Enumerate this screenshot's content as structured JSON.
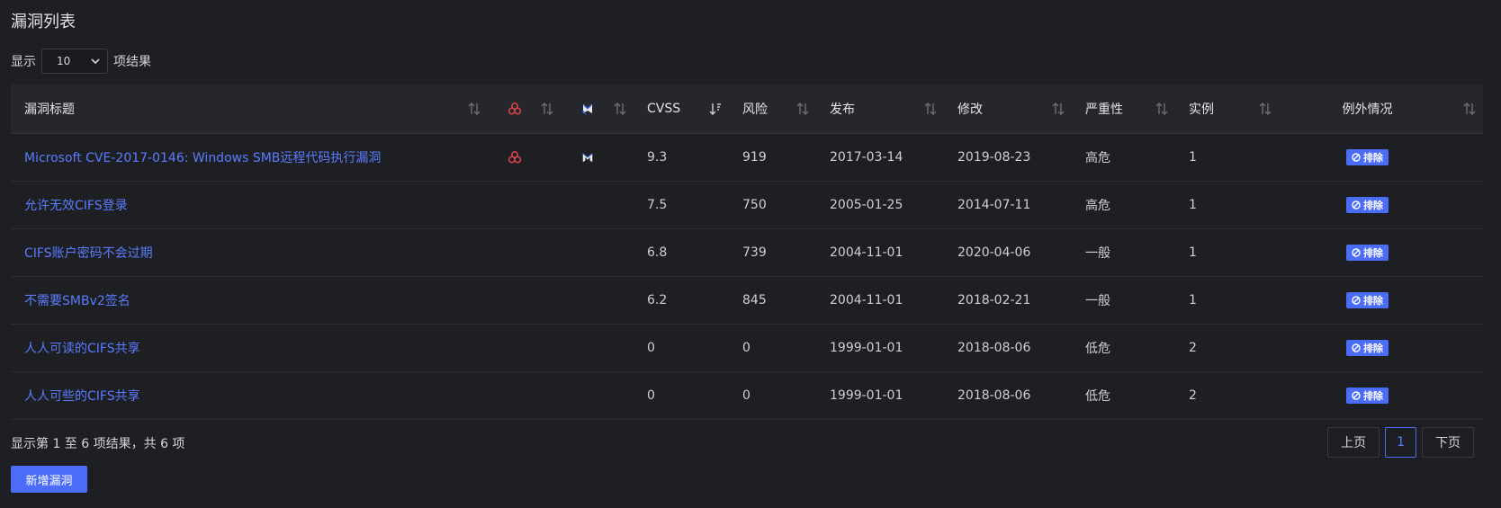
{
  "title": "漏洞列表",
  "length_menu": {
    "prefix": "显示",
    "value": "10",
    "suffix": "项结果"
  },
  "columns": {
    "title": "漏洞标题",
    "cvss": "CVSS",
    "risk": "风险",
    "published": "发布",
    "modified": "修改",
    "severity": "严重性",
    "instances": "实例",
    "exceptions": "例外情况"
  },
  "rows": [
    {
      "title": "Microsoft CVE-2017-0146: Windows SMB远程代码执行漏洞",
      "malware": true,
      "exploit": true,
      "cvss": "9.3",
      "risk": "919",
      "published": "2017-03-14",
      "modified": "2019-08-23",
      "severity": "高危",
      "instances": "1",
      "exclude": "排除"
    },
    {
      "title": "允许无效CIFS登录",
      "malware": false,
      "exploit": false,
      "cvss": "7.5",
      "risk": "750",
      "published": "2005-01-25",
      "modified": "2014-07-11",
      "severity": "高危",
      "instances": "1",
      "exclude": "排除"
    },
    {
      "title": "CIFS账户密码不会过期",
      "malware": false,
      "exploit": false,
      "cvss": "6.8",
      "risk": "739",
      "published": "2004-11-01",
      "modified": "2020-04-06",
      "severity": "一般",
      "instances": "1",
      "exclude": "排除"
    },
    {
      "title": "不需要SMBv2签名",
      "malware": false,
      "exploit": false,
      "cvss": "6.2",
      "risk": "845",
      "published": "2004-11-01",
      "modified": "2018-02-21",
      "severity": "一般",
      "instances": "1",
      "exclude": "排除"
    },
    {
      "title": "人人可读的CIFS共享",
      "malware": false,
      "exploit": false,
      "cvss": "0",
      "risk": "0",
      "published": "1999-01-01",
      "modified": "2018-08-06",
      "severity": "低危",
      "instances": "2",
      "exclude": "排除"
    },
    {
      "title": "人人可些的CIFS共享",
      "malware": false,
      "exploit": false,
      "cvss": "0",
      "risk": "0",
      "published": "1999-01-01",
      "modified": "2018-08-06",
      "severity": "低危",
      "instances": "2",
      "exclude": "排除"
    }
  ],
  "info": "显示第 1 至 6 项结果，共 6 项",
  "pagination": {
    "prev": "上页",
    "current": "1",
    "next": "下页"
  },
  "add_button": "新增漏洞",
  "icons": {
    "malware": "biohazard-icon",
    "exploit": "metasploit-icon",
    "sort": "sort-icon",
    "sort_active": "sort-desc-icon",
    "exclude": "ban-icon"
  },
  "colors": {
    "background": "#1e1f23",
    "header": "#26272c",
    "link": "#5a7cff",
    "primary": "#4a6cf7",
    "malware": "#e0424a"
  }
}
